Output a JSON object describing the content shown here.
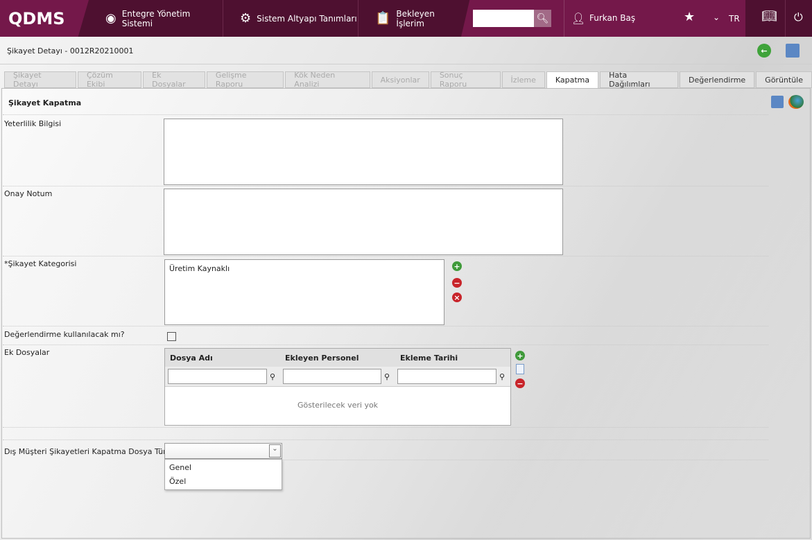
{
  "header": {
    "logo": "QDMS",
    "nav": [
      {
        "label": "Entegre Yönetim Sistemi",
        "icon": "qdms-icon"
      },
      {
        "label": "Sistem Altyapı Tanımları",
        "icon": "gear-icon"
      },
      {
        "label": "Bekleyen İşlerim",
        "icon": "clipboard-icon"
      }
    ],
    "search_value": "",
    "user": "Furkan Baş",
    "language": "TR"
  },
  "page": {
    "title": "Şikayet Detayı - 0012R20210001"
  },
  "tabs": [
    {
      "label": "Şikayet Detayı",
      "state": "disabled"
    },
    {
      "label": "Çözüm Ekibi",
      "state": "disabled"
    },
    {
      "label": "Ek Dosyalar",
      "state": "disabled"
    },
    {
      "label": "Gelişme Raporu",
      "state": "disabled"
    },
    {
      "label": "Kök Neden Analizi",
      "state": "disabled"
    },
    {
      "label": "Aksiyonlar",
      "state": "disabled"
    },
    {
      "label": "Sonuç Raporu",
      "state": "disabled"
    },
    {
      "label": "İzleme",
      "state": "disabled"
    },
    {
      "label": "Kapatma",
      "state": "active"
    },
    {
      "label": "Hata Dağılımları",
      "state": "enabled"
    },
    {
      "label": "Değerlendirme",
      "state": "enabled"
    },
    {
      "label": "Görüntüle",
      "state": "enabled"
    }
  ],
  "form": {
    "section_title": "Şikayet Kapatma",
    "yeterlilik_label": "Yeterlilik Bilgisi",
    "yeterlilik_value": "",
    "onay_label": "Onay Notum",
    "onay_value": "",
    "kategori_label": "*Şikayet Kategorisi",
    "kategori_items": [
      "Üretim Kaynaklı"
    ],
    "degerlendirme_label": "Değerlendirme kullanılacak mı?",
    "degerlendirme_checked": false,
    "ek_label": "Ek Dosyalar",
    "grid": {
      "columns": [
        "Dosya Adı",
        "Ekleyen Personel",
        "Ekleme Tarihi"
      ],
      "empty": "Gösterilecek veri yok"
    },
    "dosya_turu_label": "Dış Müşteri Şikayetleri Kapatma Dosya Türü",
    "dosya_turu_value": "",
    "dosya_turu_options": [
      "Genel",
      "Özel"
    ]
  }
}
